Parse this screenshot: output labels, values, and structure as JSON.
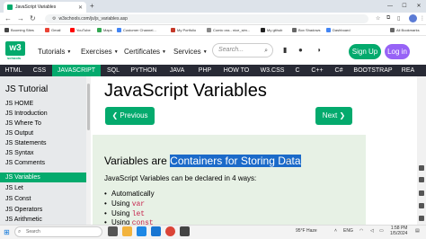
{
  "browser": {
    "tab_title": "JavaScript Variables",
    "url": "w3schools.com/js/js_variables.asp",
    "bookmarks": [
      {
        "label": "Booming Sites",
        "color": "#444"
      },
      {
        "label": "Gmail",
        "color": "#ea4335"
      },
      {
        "label": "YouTube",
        "color": "#ff0000"
      },
      {
        "label": "Maps",
        "color": "#34a853"
      },
      {
        "label": "Customer Channel...",
        "color": "#4285f4"
      },
      {
        "label": "My Portfolio",
        "color": "#c53929"
      },
      {
        "label": "Comic css - nice_sim...",
        "color": "#888"
      },
      {
        "label": "My github",
        "color": "#222"
      },
      {
        "label": "Box Shadows",
        "color": "#666"
      },
      {
        "label": "Dashboard",
        "color": "#4285f4"
      },
      {
        "label": "All Bookmarks",
        "color": "#666"
      }
    ]
  },
  "w3": {
    "logo": "w3",
    "logo_sub": "schools",
    "menu": [
      "Tutorials",
      "Exercises",
      "Certificates",
      "Services"
    ],
    "search_placeholder": "Search...",
    "signup": "Sign Up",
    "login": "Log in",
    "topbar": [
      "HTML",
      "CSS",
      "JAVASCRIPT",
      "SQL",
      "PYTHON",
      "JAVA",
      "PHP",
      "HOW TO",
      "W3.CSS",
      "C",
      "C++",
      "C#",
      "BOOTSTRAP",
      "REA"
    ]
  },
  "sidebar": {
    "title": "JS Tutorial",
    "items": [
      "JS HOME",
      "JS Introduction",
      "JS Where To",
      "JS Output",
      "JS Statements",
      "JS Syntax",
      "JS Comments",
      "JS Variables",
      "JS Let",
      "JS Const",
      "JS Operators",
      "JS Arithmetic"
    ],
    "active_index": 7
  },
  "main": {
    "title": "JavaScript Variables",
    "prev_label": "Previous",
    "next_label": "Next",
    "subhead_prefix": "Variables are ",
    "subhead_highlight": "Containers for Storing Data",
    "intro": "JavaScript Variables can be declared in 4 ways:",
    "list": [
      {
        "text": "Automatically",
        "code": ""
      },
      {
        "text": "Using ",
        "code": "var"
      },
      {
        "text": "Using ",
        "code": "let"
      },
      {
        "text": "Using ",
        "code": "const"
      }
    ]
  },
  "taskbar": {
    "search_placeholder": "Search",
    "weather": "95°F  Haze",
    "time": "1:58 PM",
    "date": "1/5/2024",
    "lang": "ENG"
  },
  "colors": {
    "accent": "#04aa6d",
    "dark_bar": "#282a35",
    "login": "#9763f6",
    "highlight": "#1b6ac9",
    "panel": "#e7f1e5"
  }
}
